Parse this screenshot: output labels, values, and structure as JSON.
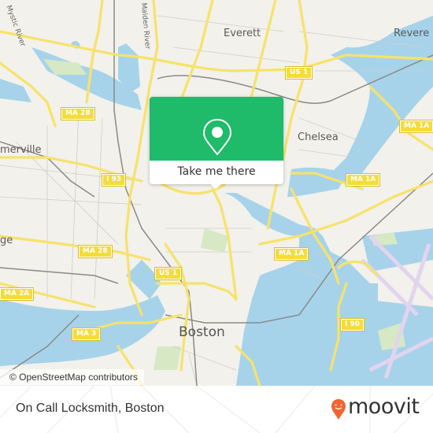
{
  "map": {
    "place_labels": {
      "everett": "Everett",
      "revere": "Revere",
      "chelsea": "Chelsea",
      "somerville": "merville",
      "cambridge": "ge",
      "boston": "Boston"
    },
    "water_labels": {
      "mystic_river": "Mystic River",
      "malden_river": "Malden River"
    },
    "road_shields": [
      {
        "id": "ma28-north",
        "label": "MA 28"
      },
      {
        "id": "us1-north",
        "label": "US 1"
      },
      {
        "id": "ma1a-east",
        "label": "MA 1A"
      },
      {
        "id": "i93",
        "label": "I 93"
      },
      {
        "id": "ma1a-mid",
        "label": "MA 1A"
      },
      {
        "id": "ma28-south",
        "label": "MA 28"
      },
      {
        "id": "us1-south",
        "label": "US 1"
      },
      {
        "id": "ma1a-south",
        "label": "MA 1A"
      },
      {
        "id": "ma2a",
        "label": "MA 2A"
      },
      {
        "id": "ma3",
        "label": "MA 3"
      },
      {
        "id": "i90",
        "label": "I 90"
      }
    ],
    "attribution": "© OpenStreetMap contributors",
    "colors": {
      "land": "#f2f1ec",
      "water": "#a6d3ea",
      "road": "#f7e26b",
      "park": "#d6e8c4",
      "rail": "#888888",
      "airport": "#e2d4ef"
    }
  },
  "popup": {
    "button_label": "Take me there",
    "icon": "map-pin-icon",
    "color": "#1fba6a"
  },
  "footer": {
    "place_name": "On Call Locksmith, Boston",
    "brand": "moovit",
    "brand_color": "#f26532"
  }
}
